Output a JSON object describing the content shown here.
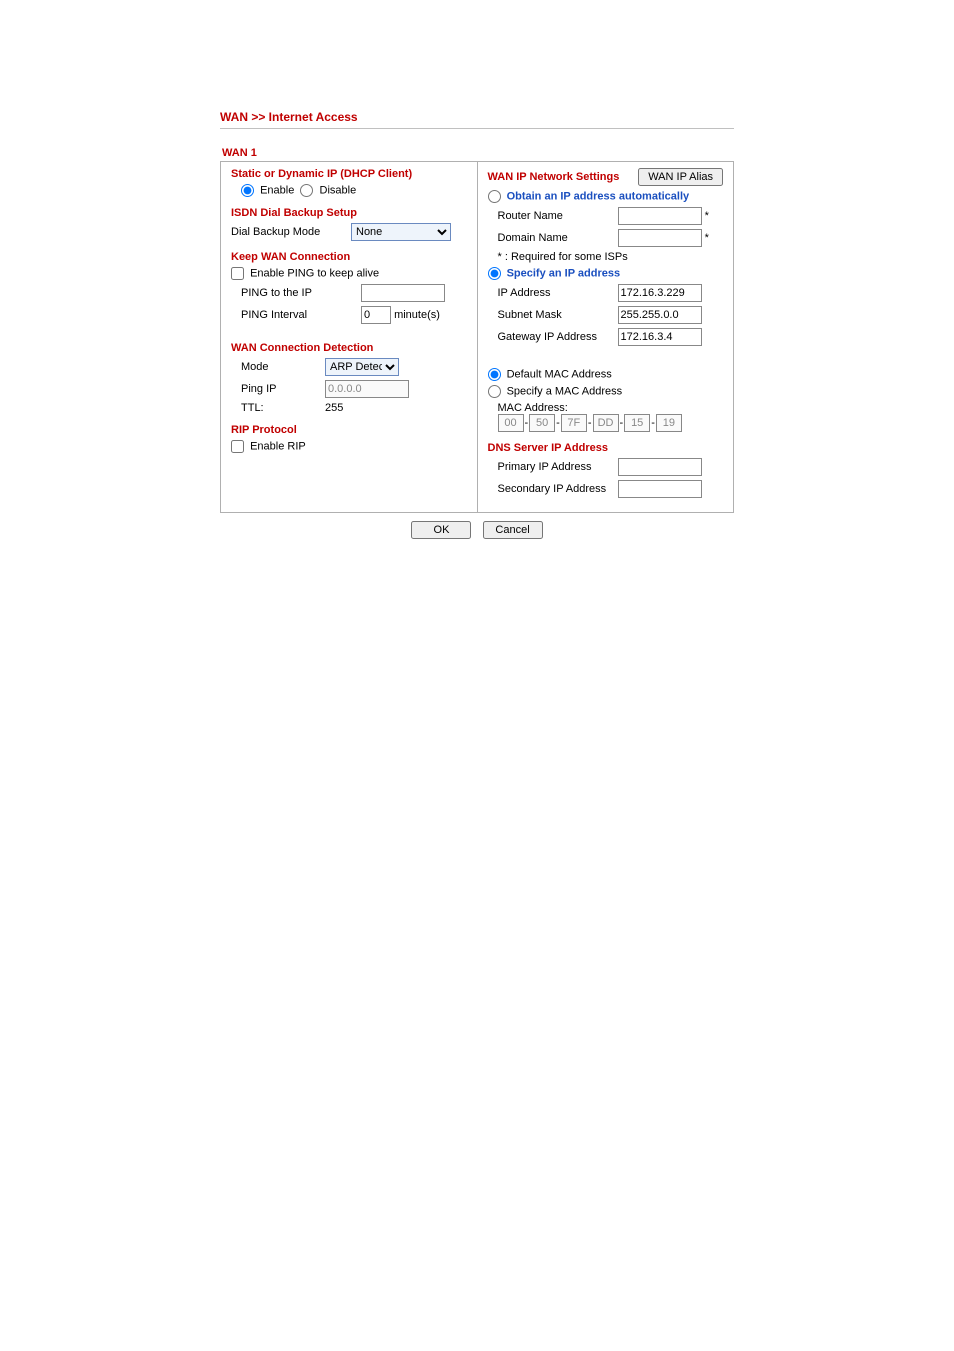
{
  "breadcrumb": "WAN >> Internet Access",
  "wan_title": "WAN 1",
  "left": {
    "dhcp_title": "Static or Dynamic IP (DHCP Client)",
    "enable_label": "Enable",
    "disable_label": "Disable",
    "dhcp_selected": "enable",
    "isdn_title": "ISDN Dial Backup Setup",
    "dial_backup_label": "Dial Backup Mode",
    "dial_backup_value": "None",
    "keep_title": "Keep WAN Connection",
    "keep_enable_label": "Enable PING to keep alive",
    "keep_enable_checked": false,
    "ping_to_label": "PING to the IP",
    "ping_to_value": "",
    "ping_interval_label": "PING Interval",
    "ping_interval_value": "0",
    "ping_interval_unit": "minute(s)",
    "detect_title": "WAN Connection Detection",
    "detect_mode_label": "Mode",
    "detect_mode_value": "ARP Detect",
    "detect_pingip_label": "Ping IP",
    "detect_pingip_value": "0.0.0.0",
    "detect_ttl_label": "TTL:",
    "detect_ttl_value": "255",
    "rip_title": "RIP Protocol",
    "rip_enable_label": "Enable RIP",
    "rip_enable_checked": false
  },
  "right": {
    "header_title": "WAN IP Network Settings",
    "alias_btn": "WAN IP Alias",
    "obtain_label": "Obtain an IP address automatically",
    "router_name_label": "Router Name",
    "router_name_value": "",
    "domain_name_label": "Domain Name",
    "domain_name_value": "",
    "required_note": "*  :  Required for some ISPs",
    "specify_label": "Specify an IP address",
    "ip_selected": "specify",
    "ip_addr_label": "IP Address",
    "ip_addr_value": "172.16.3.229",
    "subnet_label": "Subnet Mask",
    "subnet_value": "255.255.0.0",
    "gateway_label": "Gateway IP Address",
    "gateway_value": "172.16.3.4",
    "mac_default_label": "Default MAC Address",
    "mac_specify_label": "Specify a MAC Address",
    "mac_selected": "default",
    "mac_label": "MAC Address:",
    "mac": [
      "00",
      "50",
      "7F",
      "DD",
      "15",
      "19"
    ],
    "dns_title": "DNS Server IP Address",
    "dns_primary_label": "Primary IP Address",
    "dns_primary_value": "",
    "dns_secondary_label": "Secondary IP Address",
    "dns_secondary_value": ""
  },
  "buttons": {
    "ok": "OK",
    "cancel": "Cancel"
  }
}
